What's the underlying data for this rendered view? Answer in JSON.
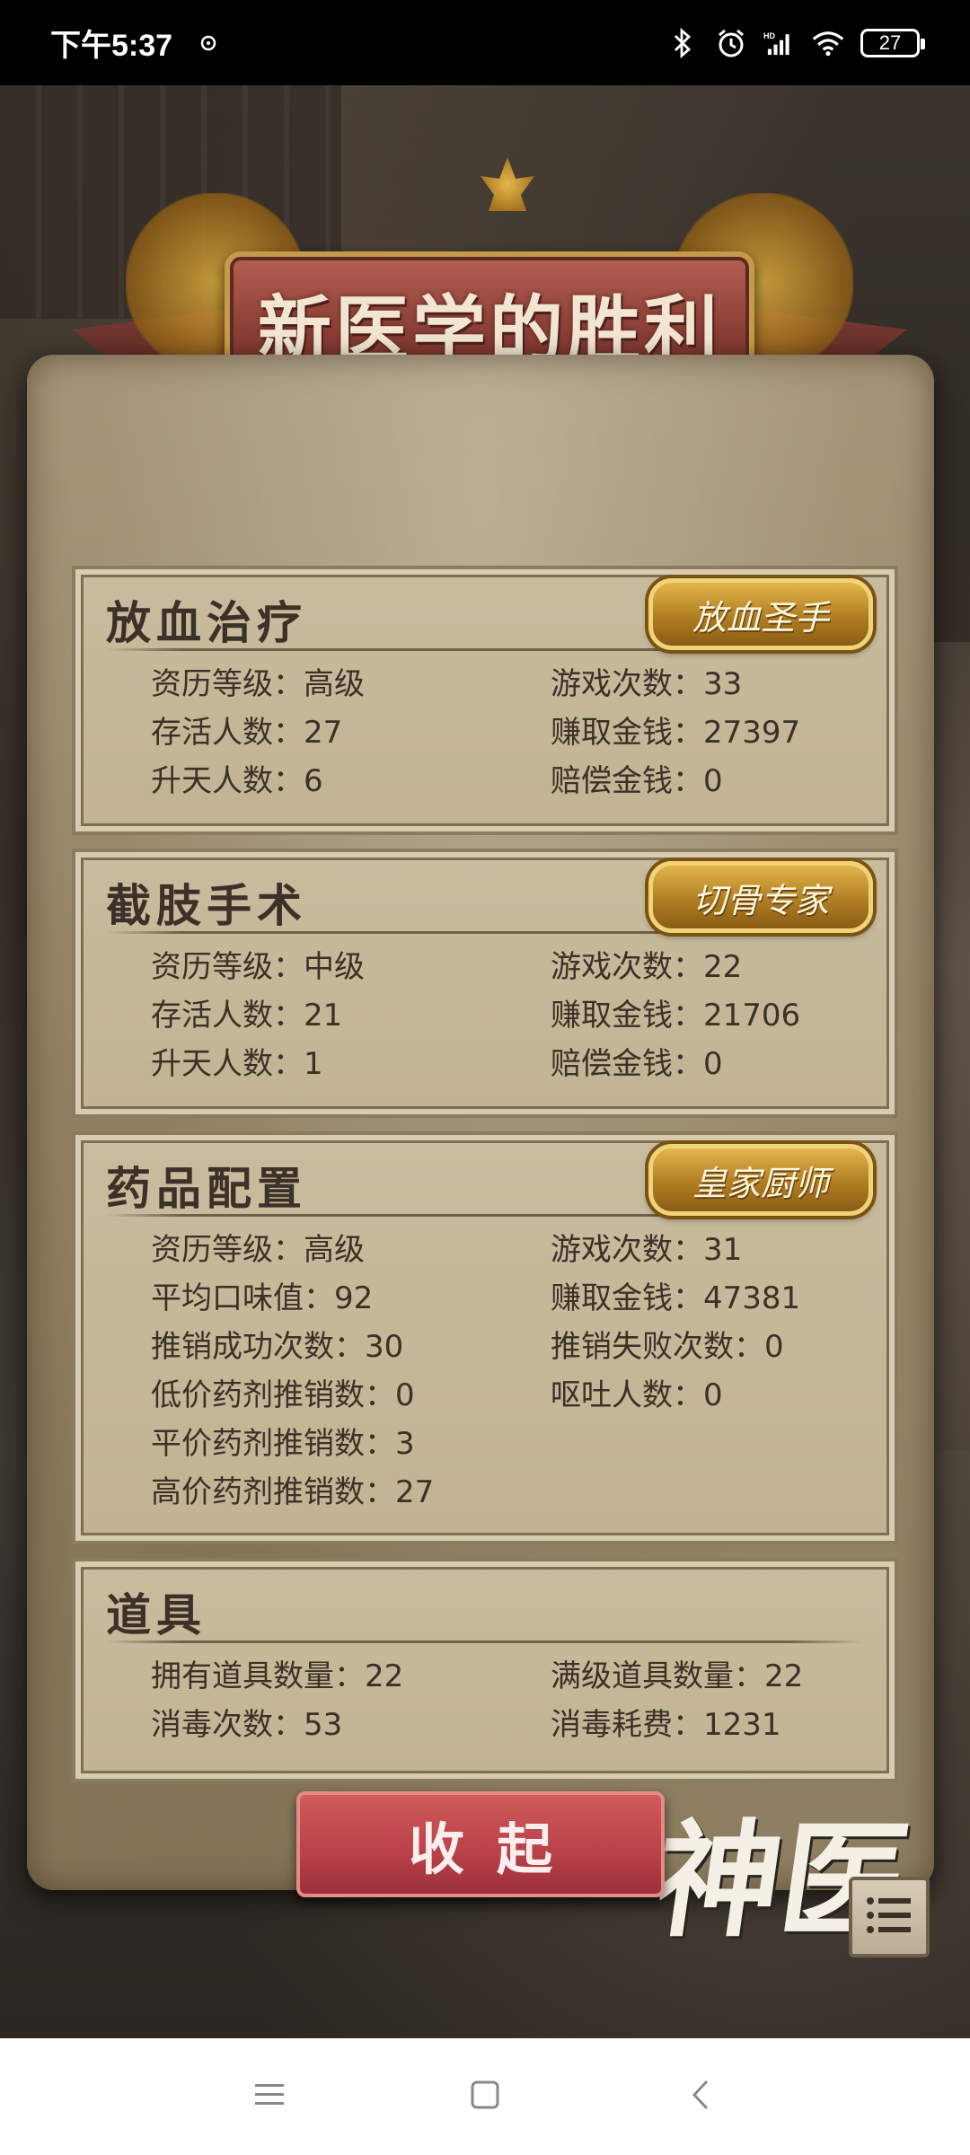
{
  "status_bar": {
    "time": "下午5:37",
    "battery": "27",
    "icons": [
      "notification-icon",
      "bluetooth-icon",
      "alarm-icon",
      "signal-hd-icon",
      "wifi-icon",
      "battery-icon"
    ]
  },
  "title_banner": "新医学的胜利",
  "panels": [
    {
      "title": "放血治疗",
      "badge": "放血圣手",
      "stats": [
        "资历等级：高级",
        "游戏次数：33",
        "存活人数：27",
        "赚取金钱：27397",
        "升天人数：6",
        "赔偿金钱：0"
      ]
    },
    {
      "title": "截肢手术",
      "badge": "切骨专家",
      "stats": [
        "资历等级：中级",
        "游戏次数：22",
        "存活人数：21",
        "赚取金钱：21706",
        "升天人数：1",
        "赔偿金钱：0"
      ]
    },
    {
      "title": "药品配置",
      "badge": "皇家厨师",
      "stats": [
        "资历等级：高级",
        "游戏次数：31",
        "平均口味值：92",
        "赚取金钱：47381",
        "推销成功次数：30",
        "推销失败次数：0",
        "低价药剂推销数：0",
        "呕吐人数：0",
        "平价药剂推销数：3",
        "",
        "高价药剂推销数：27",
        ""
      ]
    },
    {
      "title": "道具",
      "stats": [
        "拥有道具数量：22",
        "满级道具数量：22",
        "消毒次数：53",
        "消毒耗费：1231"
      ]
    }
  ],
  "collapse_button": "收起",
  "logo_text": "神医",
  "colors": {
    "banner_red": "#8f4239",
    "badge_gold": "#e3b64c",
    "button_red": "#b8414a",
    "parchment": "#c9bc9e"
  }
}
